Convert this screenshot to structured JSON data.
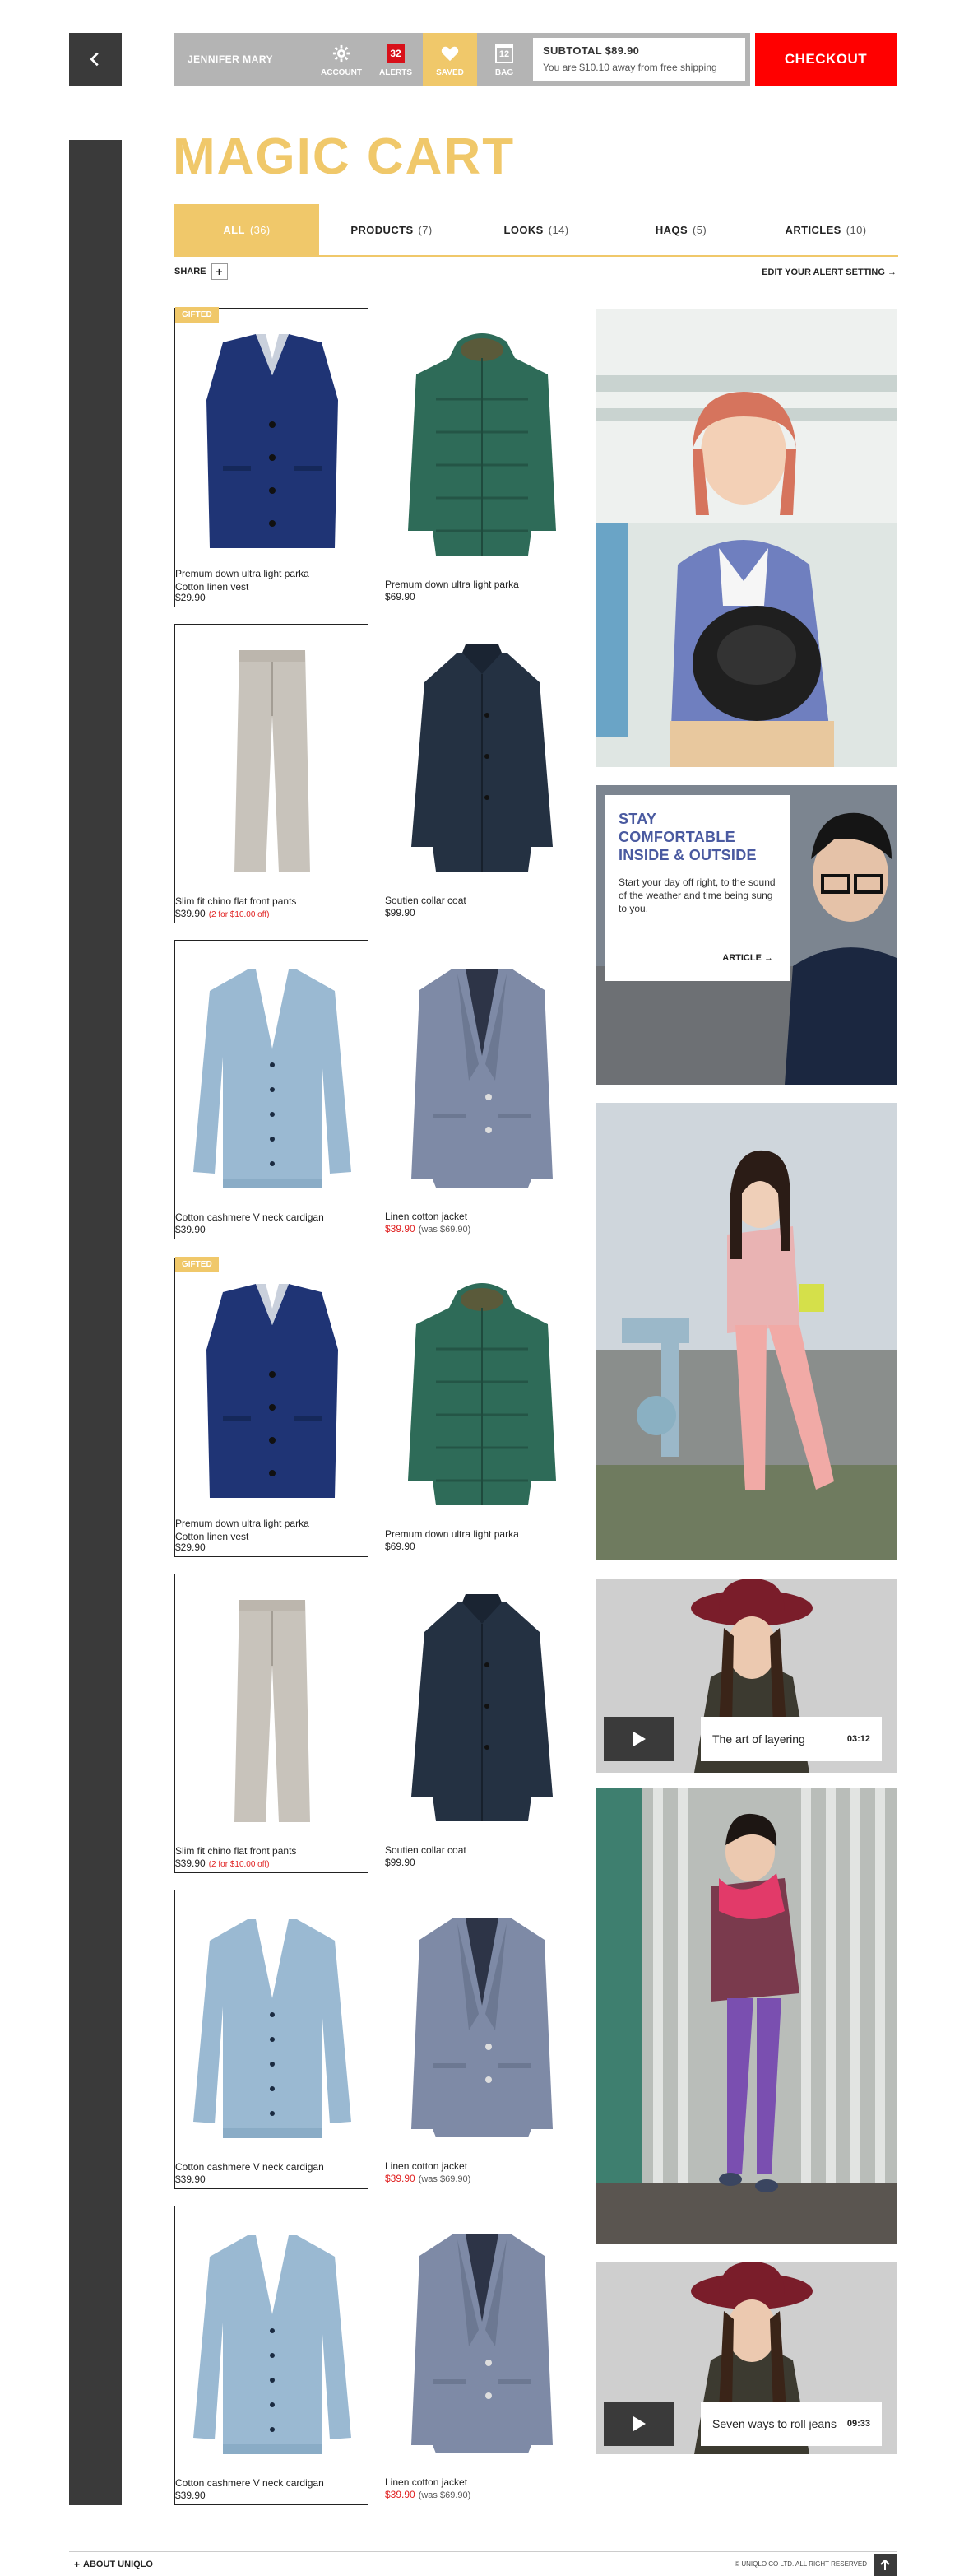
{
  "topbar": {
    "back_icon": "chevron-left-icon",
    "user_name": "JENNIFER MARY",
    "account_label": "ACCOUNT",
    "alerts_label": "ALERTS",
    "alerts_count": "32",
    "saved_label": "SAVED",
    "bag_label": "BAG",
    "bag_count": "12",
    "subtotal": "SUBTOTAL $89.90",
    "shipping_note": "You are $10.10 away from free shipping",
    "checkout_label": "CHECKOUT"
  },
  "page_title": "MAGIC CART",
  "tabs": [
    {
      "label": "ALL",
      "count": "(36)"
    },
    {
      "label": "PRODUCTS",
      "count": "(7)"
    },
    {
      "label": "LOOKS",
      "count": "(14)"
    },
    {
      "label": "HAQS",
      "count": "(5)"
    },
    {
      "label": "ARTICLES",
      "count": "(10)"
    }
  ],
  "share_label": "SHARE",
  "alert_setting_label": "EDIT YOUR ALERT SETTING",
  "gifted_label": "GIFTED",
  "products": [
    {
      "name": "Premum down ultra light parka\nCotton linen vest",
      "price": "$29.90",
      "note": "",
      "was": "",
      "sale": false,
      "art": "vest",
      "boxed": true,
      "gifted": true
    },
    {
      "name": "Premum down ultra light parka",
      "price": "$69.90",
      "note": "",
      "was": "",
      "sale": false,
      "art": "parka",
      "boxed": false,
      "gifted": false
    },
    {
      "name": "Slim fit chino flat front pants",
      "price": "$39.90",
      "note": "(2 for $10.00 off)",
      "was": "",
      "sale": false,
      "art": "pants",
      "boxed": true,
      "gifted": false
    },
    {
      "name": "Soutien collar coat",
      "price": "$99.90",
      "note": "",
      "was": "",
      "sale": false,
      "art": "coat",
      "boxed": false,
      "gifted": false
    },
    {
      "name": "Cotton cashmere V neck  cardigan",
      "price": "$39.90",
      "note": "",
      "was": "",
      "sale": false,
      "art": "cardigan",
      "boxed": true,
      "gifted": false
    },
    {
      "name": "Linen cotton jacket",
      "price": "$39.90",
      "note": "",
      "was": "(was $69.90)",
      "sale": true,
      "art": "jacket",
      "boxed": false,
      "gifted": false
    },
    {
      "name": "Premum down ultra light parka\nCotton linen vest",
      "price": "$29.90",
      "note": "",
      "was": "",
      "sale": false,
      "art": "vest",
      "boxed": true,
      "gifted": true
    },
    {
      "name": "Premum down ultra light parka",
      "price": "$69.90",
      "note": "",
      "was": "",
      "sale": false,
      "art": "parka",
      "boxed": false,
      "gifted": false
    },
    {
      "name": "Slim fit chino flat front pants",
      "price": "$39.90",
      "note": "(2 for $10.00 off)",
      "was": "",
      "sale": false,
      "art": "pants",
      "boxed": true,
      "gifted": false
    },
    {
      "name": "Soutien collar coat",
      "price": "$99.90",
      "note": "",
      "was": "",
      "sale": false,
      "art": "coat",
      "boxed": false,
      "gifted": false
    },
    {
      "name": "Cotton cashmere V neck  cardigan",
      "price": "$39.90",
      "note": "",
      "was": "",
      "sale": false,
      "art": "cardigan",
      "boxed": true,
      "gifted": false
    },
    {
      "name": "Linen cotton jacket",
      "price": "$39.90",
      "note": "",
      "was": "(was $69.90)",
      "sale": true,
      "art": "jacket",
      "boxed": false,
      "gifted": false
    },
    {
      "name": "Cotton cashmere V neck  cardigan",
      "price": "$39.90",
      "note": "",
      "was": "",
      "sale": false,
      "art": "cardigan",
      "boxed": true,
      "gifted": false
    },
    {
      "name": "Linen cotton jacket",
      "price": "$39.90",
      "note": "",
      "was": "(was $69.90)",
      "sale": true,
      "art": "jacket",
      "boxed": false,
      "gifted": false
    }
  ],
  "article": {
    "heading": "STAY COMFORTABLE\nINSIDE & OUTSIDE",
    "body": "Start your day off right, to the sound of the weather and time being sung to you.",
    "link": "ARTICLE"
  },
  "videos": [
    {
      "title": "The art of layering",
      "duration": "03:12"
    },
    {
      "title": "Seven ways to roll jeans",
      "duration": "09:33"
    }
  ],
  "footer": {
    "about": "ABOUT UNIQLO",
    "copyright": "© UNIQLO CO LTD. ALL RIGHT RESERVED"
  },
  "colors": {
    "accent_yellow": "#f0c86a",
    "checkout_red": "#ff0000",
    "sidebar_dark": "#3a3a3a",
    "alert_red": "#d8101a",
    "article_blue": "#4a5aa0"
  }
}
